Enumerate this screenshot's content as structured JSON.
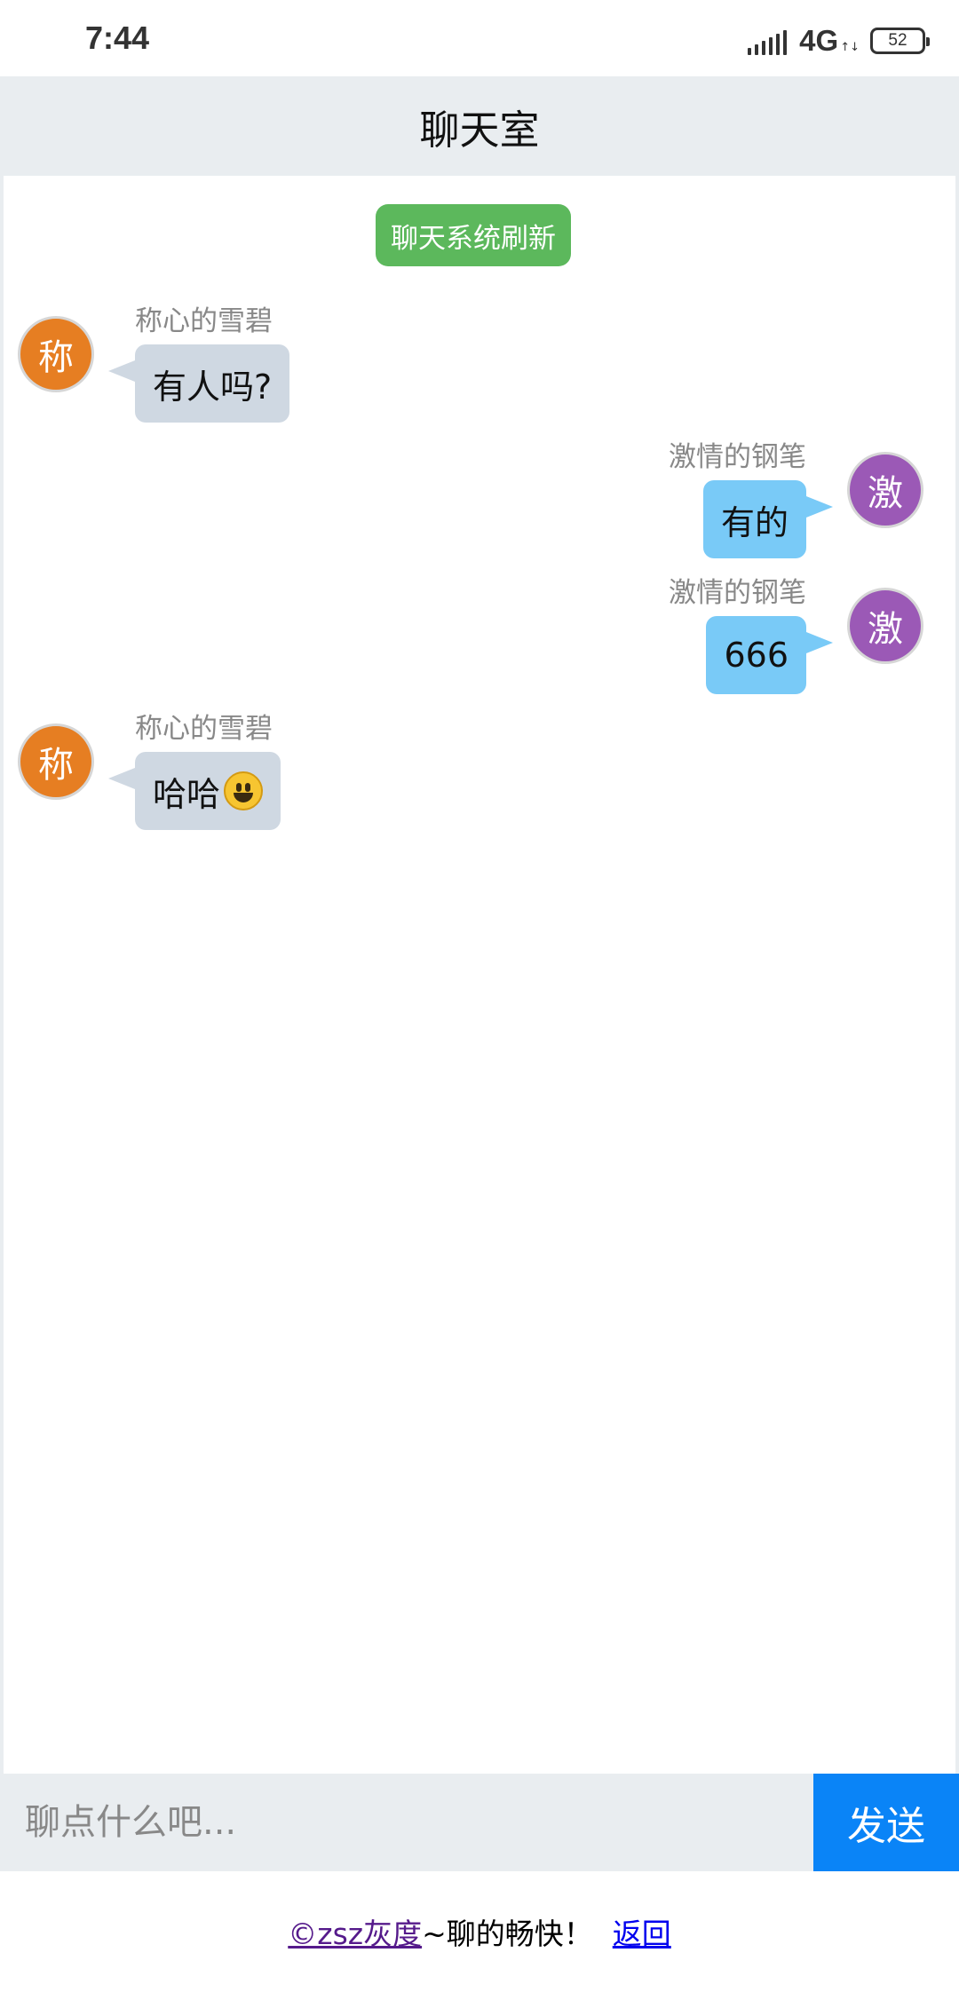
{
  "status_bar": {
    "time": "7:44",
    "network": "4G",
    "battery": "52"
  },
  "header": {
    "title": "聊天室"
  },
  "chat": {
    "refresh_label": "聊天系统刷新",
    "messages": [
      {
        "side": "left",
        "avatar": "称",
        "avatar_color": "#e67e22",
        "sender": "称心的雪碧",
        "text": "有人吗?"
      },
      {
        "side": "right",
        "avatar": "激",
        "avatar_color": "#9b59b6",
        "sender": "激情的钢笔",
        "text": "有的"
      },
      {
        "side": "right",
        "avatar": "激",
        "avatar_color": "#9b59b6",
        "sender": "激情的钢笔",
        "text": "666"
      },
      {
        "side": "left",
        "avatar": "称",
        "avatar_color": "#e67e22",
        "sender": "称心的雪碧",
        "text": "哈哈",
        "emoji": "grinning-face-emoji-icon"
      }
    ]
  },
  "composer": {
    "placeholder": "聊点什么吧...",
    "send_label": "发送"
  },
  "footer": {
    "copyright": "©zsz灰度",
    "slogan": "~聊的畅快！",
    "back_label": "返回"
  },
  "colors": {
    "header_bg": "#e9edf0",
    "refresh_bg": "#5cb85c",
    "send_bg": "#0a84f7",
    "left_bubble": "#cfd8e2",
    "right_bubble": "#79caf7"
  }
}
